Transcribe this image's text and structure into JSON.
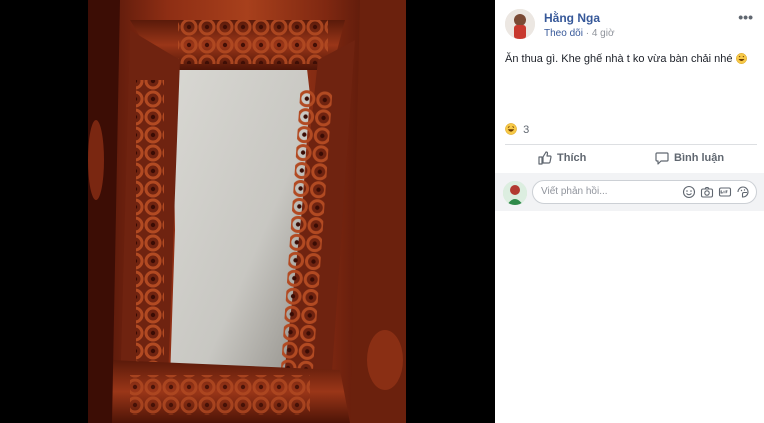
{
  "post": {
    "author": "Hằng Nga",
    "follow_label": "Theo dõi",
    "separator": "·",
    "time": "4 giờ",
    "text": "Ăn thua gì. Khe ghế nhà t ko vừa bàn chải nhé",
    "text_emoji": "laughing-face-icon",
    "reaction_count": "3",
    "more_label": "•••"
  },
  "actions": {
    "like_label": "Thích",
    "comment_label": "Bình luận"
  },
  "comment": {
    "placeholder": "Viết phản hồi..."
  },
  "colors": {
    "link": "#365899",
    "muted": "#90949c",
    "panel": "#ffffff",
    "backdrop": "#000000"
  }
}
